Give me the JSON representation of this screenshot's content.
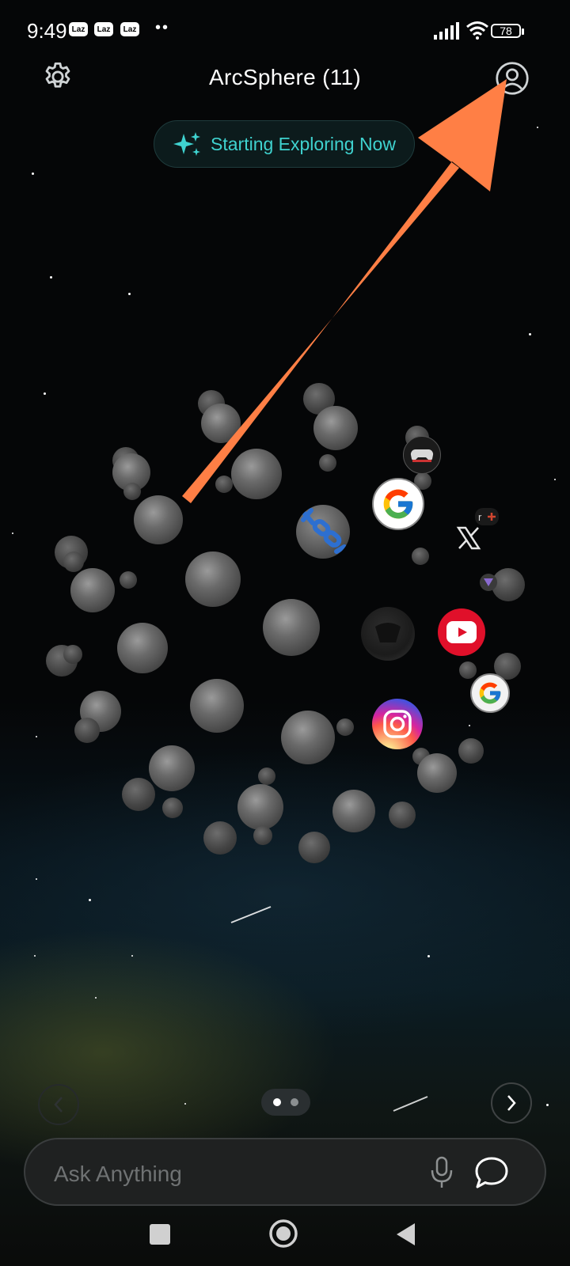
{
  "status_bar": {
    "time": "9:49",
    "notification_badges": [
      "Laz",
      "Laz",
      "Laz"
    ],
    "more_dots": "••",
    "battery": "78"
  },
  "header": {
    "settings_icon": "gear-icon",
    "title": "ArcSphere (11)",
    "profile_icon": "user-circle-icon"
  },
  "explore_button": {
    "icon": "sparkles-icon",
    "label": "Starting Exploring Now"
  },
  "annotation": {
    "type": "arrow",
    "color": "#FF7F45"
  },
  "sphere": {
    "apps": [
      {
        "name": "game-controller-app-icon"
      },
      {
        "name": "google-app-icon"
      },
      {
        "name": "link-app-icon"
      },
      {
        "name": "x-app-icon"
      },
      {
        "name": "plus-app-icon"
      },
      {
        "name": "shield-app-icon"
      },
      {
        "name": "dark-app-icon"
      },
      {
        "name": "youtube-app-icon"
      },
      {
        "name": "google-app-icon-small"
      },
      {
        "name": "instagram-app-icon"
      }
    ]
  },
  "pager": {
    "pages": 2,
    "active_page": 1
  },
  "ask_bar": {
    "placeholder": "Ask Anything",
    "mic_icon": "microphone-icon",
    "chat_icon": "chat-bubble-icon"
  },
  "system_nav": [
    "recent-apps-icon",
    "home-icon",
    "back-icon"
  ]
}
